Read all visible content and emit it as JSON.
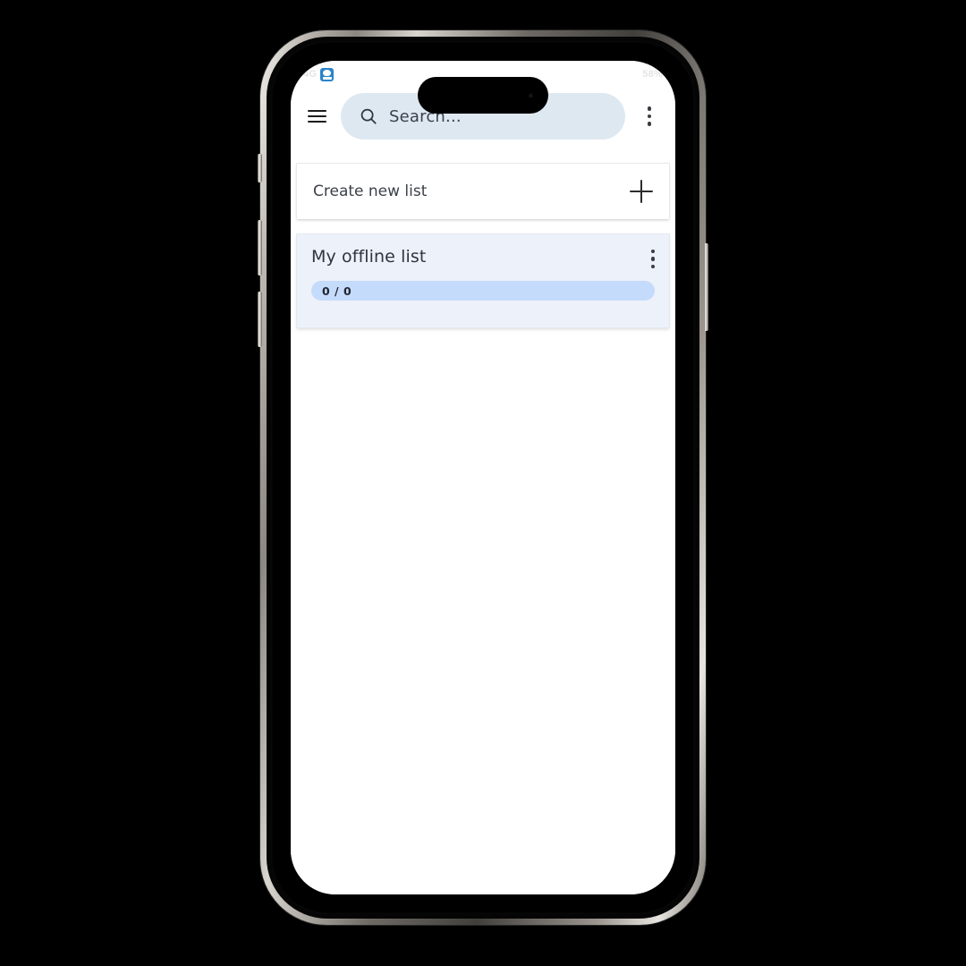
{
  "device": {
    "type": "smartphone-mockup",
    "orientation": "portrait"
  },
  "status_bar": {
    "left_ghost_text": "4G",
    "app_icon_name": "notification-app-icon",
    "right_ghost_text": "58%"
  },
  "app_bar": {
    "menu_icon": "hamburger-menu-icon",
    "search": {
      "icon": "search-icon",
      "placeholder": "Search...",
      "value": ""
    },
    "overflow_icon": "more-vertical-icon"
  },
  "create_card": {
    "label": "Create new list",
    "add_icon": "plus-icon"
  },
  "lists": [
    {
      "title": "My offline list",
      "overflow_icon": "more-vertical-icon",
      "progress_label": "0 / 0",
      "completed": 0,
      "total": 0,
      "percent": 0
    }
  ],
  "colors": {
    "search_bg": "#dee8f1",
    "card_list_bg": "#edf1f9",
    "progress_fill": "#c5dbfb",
    "text_primary": "#30343c",
    "screen_bg": "#ffffff"
  }
}
